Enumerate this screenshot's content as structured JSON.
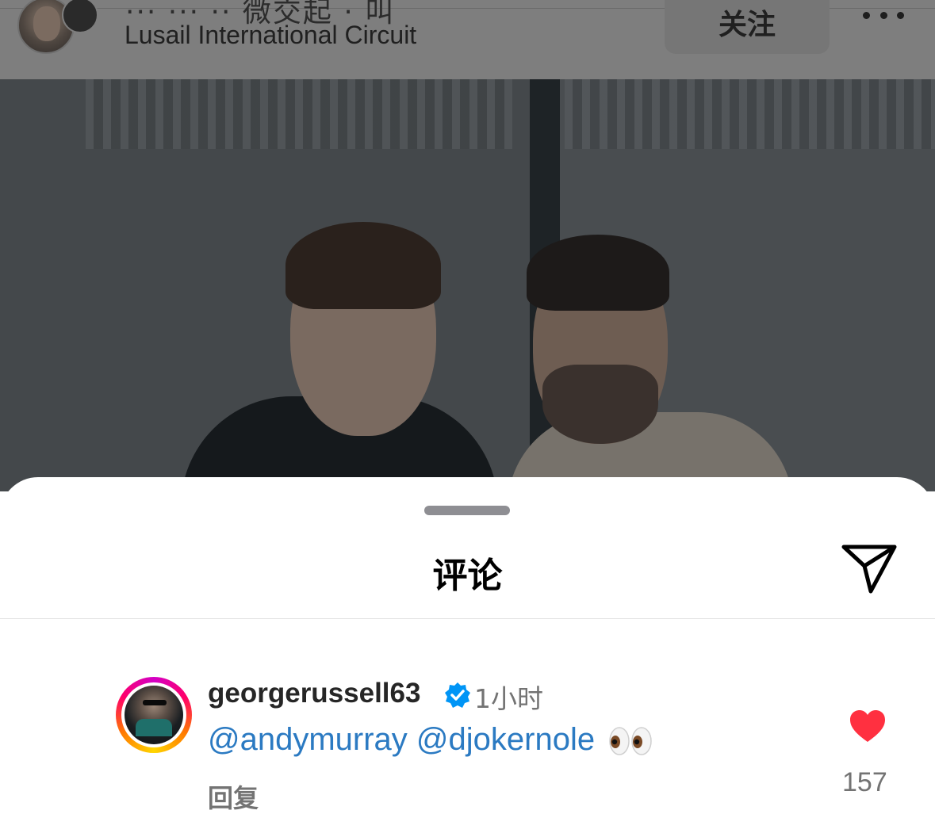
{
  "post_header": {
    "title_partial": "··· ··· ·· 微交起 · 叫",
    "location": "Lusail International Circuit",
    "follow_label": "关注"
  },
  "sheet": {
    "title": "评论"
  },
  "comment": {
    "username": "georgerussell63",
    "verified": true,
    "time": "1小时",
    "mentions": [
      "@andymurray",
      "@djokernole"
    ],
    "emoji": "👀",
    "reply_label": "回复",
    "like_count": "157"
  },
  "colors": {
    "mention": "#2b7ac2",
    "like_heart": "#ff3040",
    "verified_badge": "#0095f6",
    "overlay_dim": "#7e7e7e"
  },
  "icons": {
    "more": "more-dots-icon",
    "share": "paper-plane-icon",
    "verified": "verified-badge-icon",
    "like": "heart-icon"
  }
}
